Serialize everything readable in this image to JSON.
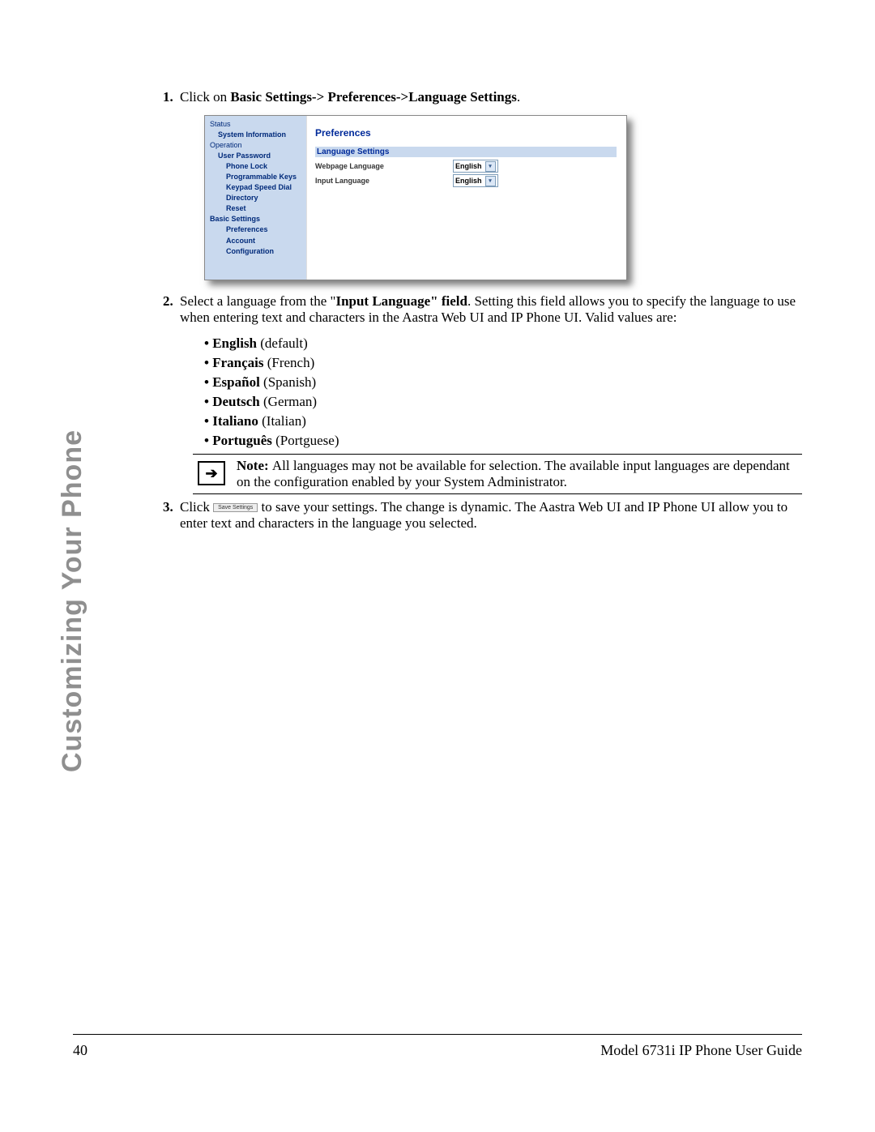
{
  "side_title": "Customizing Your Phone",
  "step1": {
    "prefix": "Click on ",
    "bold": "Basic Settings-> Preferences->Language Settings",
    "suffix": "."
  },
  "screenshot": {
    "sidebar": {
      "status": "Status",
      "system_info": "System Information",
      "operation": "Operation",
      "user_password": "User Password",
      "phone_lock": "Phone Lock",
      "programmable_keys": "Programmable Keys",
      "keypad_speed_dial": "Keypad Speed Dial",
      "directory": "Directory",
      "reset": "Reset",
      "basic_settings": "Basic Settings",
      "preferences": "Preferences",
      "account_config": "Account Configuration"
    },
    "main": {
      "title": "Preferences",
      "section": "Language Settings",
      "row1_label": "Webpage Language",
      "row1_value": "English",
      "row2_label": "Input Language",
      "row2_value": "English"
    }
  },
  "step2": {
    "pre": "Select a language from the \"",
    "bold": "Input Language\" field",
    "post": ". Setting this field allows you to specify the language to use when entering text and characters in the Aastra Web UI and IP Phone UI. Valid values are:"
  },
  "languages": [
    {
      "bold": "English",
      "rest": " (default)"
    },
    {
      "bold": "Français",
      "rest": " (French)"
    },
    {
      "bold": "Español",
      "rest": " (Spanish)"
    },
    {
      "bold": "Deutsch",
      "rest": " (German)"
    },
    {
      "bold": "Italiano",
      "rest": " (Italian)"
    },
    {
      "bold": "Português",
      "rest": " (Portguese)"
    }
  ],
  "note": {
    "label": "Note: ",
    "text": "All languages may not be available for selection. The available input languages are dependant on the configuration enabled by your System Administrator."
  },
  "step3": {
    "pre": "Click ",
    "button": "Save Settings",
    "post": " to save your settings. The change is dynamic. The Aastra Web UI and IP Phone UI allow you to enter text and characters in the language you selected."
  },
  "footer": {
    "page": "40",
    "title": "Model 6731i IP Phone User Guide"
  }
}
